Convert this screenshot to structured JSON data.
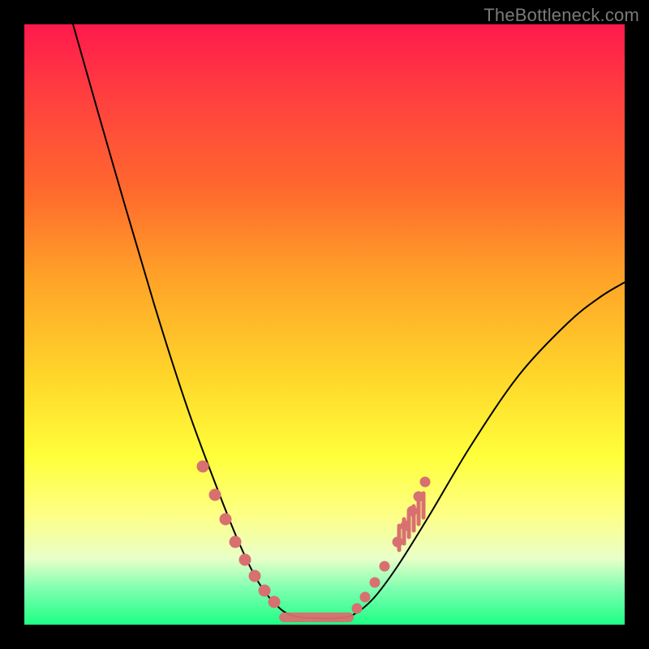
{
  "watermark": "TheBottleneck.com",
  "chart_data": {
    "type": "line",
    "title": "",
    "xlabel": "",
    "ylabel": "",
    "xlim": [
      0,
      740
    ],
    "ylim": [
      0,
      740
    ],
    "curve": {
      "description": "V-shaped bottleneck curve rendered on a vertical red→green gradient. Y encodes bottleneck severity (top=high/red, bottom=low/green). Minimum sits slightly left of center then the right branch climbs with a gentle concave bow.",
      "left_branch": [
        {
          "x": 60,
          "y": 0
        },
        {
          "x": 110,
          "y": 175
        },
        {
          "x": 160,
          "y": 345
        },
        {
          "x": 200,
          "y": 470
        },
        {
          "x": 235,
          "y": 565
        },
        {
          "x": 265,
          "y": 640
        },
        {
          "x": 290,
          "y": 690
        },
        {
          "x": 315,
          "y": 720
        },
        {
          "x": 335,
          "y": 730
        }
      ],
      "valley": [
        {
          "x": 335,
          "y": 730
        },
        {
          "x": 360,
          "y": 732
        },
        {
          "x": 385,
          "y": 732
        },
        {
          "x": 405,
          "y": 728
        }
      ],
      "right_branch": [
        {
          "x": 405,
          "y": 728
        },
        {
          "x": 430,
          "y": 708
        },
        {
          "x": 460,
          "y": 668
        },
        {
          "x": 500,
          "y": 604
        },
        {
          "x": 550,
          "y": 520
        },
        {
          "x": 610,
          "y": 432
        },
        {
          "x": 670,
          "y": 368
        },
        {
          "x": 710,
          "y": 336
        },
        {
          "x": 740,
          "y": 318
        }
      ]
    },
    "markers_left": [
      {
        "x": 220,
        "y": 545
      },
      {
        "x": 235,
        "y": 580
      },
      {
        "x": 248,
        "y": 610
      },
      {
        "x": 260,
        "y": 638
      },
      {
        "x": 272,
        "y": 660
      },
      {
        "x": 284,
        "y": 680
      },
      {
        "x": 296,
        "y": 698
      },
      {
        "x": 308,
        "y": 712
      }
    ],
    "markers_right": [
      {
        "x": 410,
        "y": 720
      },
      {
        "x": 420,
        "y": 706
      },
      {
        "x": 432,
        "y": 688
      },
      {
        "x": 444,
        "y": 668
      },
      {
        "x": 460,
        "y": 638
      },
      {
        "x": 470,
        "y": 618
      },
      {
        "x": 478,
        "y": 600
      },
      {
        "x": 486,
        "y": 582
      },
      {
        "x": 494,
        "y": 564
      }
    ],
    "valley_band": {
      "x1": 320,
      "x2": 400,
      "y": 731
    },
    "right_hash_ticks": [
      {
        "x": 462,
        "y1": 618,
        "y2": 648
      },
      {
        "x": 468,
        "y1": 610,
        "y2": 640
      },
      {
        "x": 474,
        "y1": 602,
        "y2": 632
      },
      {
        "x": 480,
        "y1": 594,
        "y2": 624
      },
      {
        "x": 486,
        "y1": 586,
        "y2": 616
      },
      {
        "x": 492,
        "y1": 578,
        "y2": 608
      }
    ]
  }
}
